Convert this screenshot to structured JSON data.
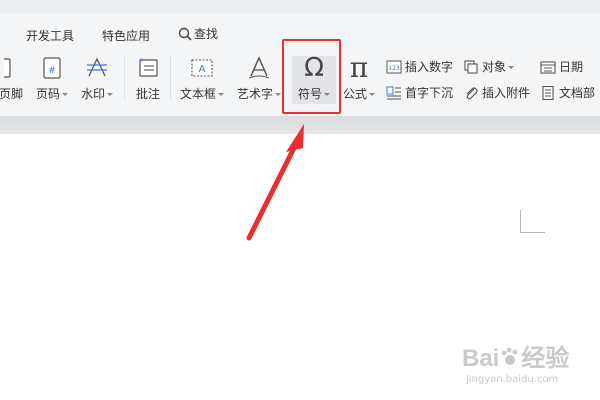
{
  "tabs": {
    "dev_tools": "开发工具",
    "special_apps": "特色应用",
    "search": "查找"
  },
  "ribbon": {
    "header_footer": "页脚",
    "page_number": "页码",
    "watermark": "水印",
    "comment": "批注",
    "text_box": "文本框",
    "word_art": "艺术字",
    "symbol": "符号",
    "formula": "公式",
    "insert_number": "插入数字",
    "object": "对象",
    "date": "日期",
    "drop_cap": "首字下沉",
    "insert_attachment": "插入附件",
    "document_part": "文档部"
  },
  "icons": {
    "symbol_glyph": "Ω",
    "formula_glyph": "π"
  },
  "watermark": {
    "brand": "Bai",
    "brand_suffix": "经验",
    "url": "jingyan.baidu.com"
  },
  "colors": {
    "highlight": "#e83030",
    "arrow": "#e83030"
  }
}
